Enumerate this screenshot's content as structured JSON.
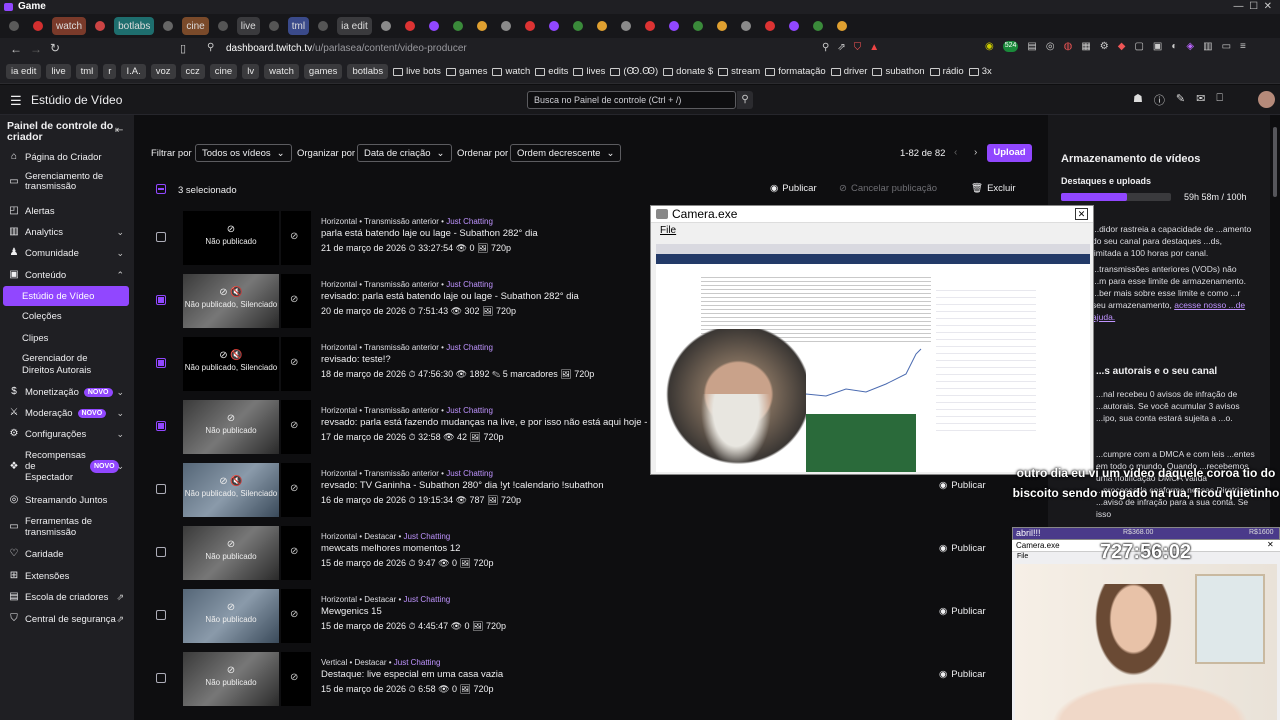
{
  "window": {
    "title": "Game"
  },
  "browser_tabs": [
    {
      "label": "",
      "color": "#5a5a5a"
    },
    {
      "label": "",
      "color": "#d32f2f"
    },
    {
      "label": "watch",
      "color": "#7a3a2a"
    },
    {
      "label": "",
      "color": "#c44"
    },
    {
      "label": "botlabs",
      "color": "#1e6e6e"
    },
    {
      "label": "",
      "color": "#666"
    },
    {
      "label": "cine",
      "color": "#7a4a2a"
    },
    {
      "label": "",
      "color": "#555"
    },
    {
      "label": "live",
      "color": "#3a3a3d"
    },
    {
      "label": "",
      "color": "#555"
    },
    {
      "label": "tml",
      "color": "#3a4a8a"
    },
    {
      "label": "",
      "color": "#555"
    },
    {
      "label": "ia edit",
      "color": "#3a3a3d"
    }
  ],
  "address": {
    "url_host": "dashboard.twitch.tv",
    "url_path": "/u/parlasea/content/video-producer"
  },
  "bookmarks": [
    {
      "label": "ia edit",
      "pill": true
    },
    {
      "label": "live",
      "pill": true
    },
    {
      "label": "tml",
      "pill": true
    },
    {
      "label": "r",
      "pill": true
    },
    {
      "label": "I.A.",
      "pill": true
    },
    {
      "label": "voz",
      "pill": true
    },
    {
      "label": "ccz",
      "pill": true
    },
    {
      "label": "cine",
      "pill": true
    },
    {
      "label": "lv",
      "pill": true
    },
    {
      "label": "watch",
      "pill": true
    },
    {
      "label": "games",
      "pill": true
    },
    {
      "label": "botlabs",
      "pill": true
    },
    {
      "label": "live bots",
      "pill": false
    },
    {
      "label": "games",
      "pill": false
    },
    {
      "label": "watch",
      "pill": false
    },
    {
      "label": "edits",
      "pill": false
    },
    {
      "label": "lives",
      "pill": false
    },
    {
      "label": "(Ꙭ.Ꙭ)",
      "pill": false
    },
    {
      "label": "donate $",
      "pill": false
    },
    {
      "label": "stream",
      "pill": false
    },
    {
      "label": "formatação",
      "pill": false
    },
    {
      "label": "driver",
      "pill": false
    },
    {
      "label": "subathon",
      "pill": false
    },
    {
      "label": "rádio",
      "pill": false
    },
    {
      "label": "3x",
      "pill": false
    }
  ],
  "header": {
    "title": "Estúdio de Vídeo",
    "search_placeholder": "Busca no Painel de controle (Ctrl + /)"
  },
  "sidebar": {
    "title": "Painel de controle do criador",
    "items": [
      {
        "label": "Página do Criador"
      },
      {
        "label": "Gerenciamento de transmissão"
      },
      {
        "label": "Alertas"
      },
      {
        "label": "Analytics"
      },
      {
        "label": "Comunidade"
      },
      {
        "label": "Conteúdo"
      },
      {
        "label": "Estúdio de Vídeo"
      },
      {
        "label": "Coleções"
      },
      {
        "label": "Clipes"
      },
      {
        "label": "Gerenciador de Direitos Autorais"
      },
      {
        "label": "Monetização",
        "badge": "NOVO"
      },
      {
        "label": "Moderação",
        "badge": "NOVO"
      },
      {
        "label": "Configurações"
      },
      {
        "label": "Recompensas de Espectador",
        "badge": "NOVO"
      },
      {
        "label": "Streamando Juntos"
      },
      {
        "label": "Ferramentas de transmissão"
      },
      {
        "label": "Caridade"
      },
      {
        "label": "Extensões"
      },
      {
        "label": "Escola de criadores"
      },
      {
        "label": "Central de segurança"
      }
    ]
  },
  "filters": {
    "filter_label": "Filtrar por",
    "filter_value": "Todos os vídeos",
    "organize_label": "Organizar por",
    "organize_value": "Data de criação",
    "order_label": "Ordenar por",
    "order_value": "Ordem decrescente",
    "pagination": "1-82 de 82",
    "upload": "Upload"
  },
  "bulk": {
    "selected": "3 selecionado",
    "publish": "Publicar",
    "cancel": "Cancelar publicação",
    "delete": "Excluir"
  },
  "videos": [
    {
      "meta": "Horizontal • Transmissão anterior • ",
      "category": "Just Chatting",
      "title": "parla está batendo laje ou lage - Subathon 282° dia",
      "stats": "21 de março de 2026  ⏱ 33:27:54  👁 0  🖼 720p",
      "thumb_label": "Não publicado",
      "checked": false,
      "publish": ""
    },
    {
      "meta": "Horizontal • Transmissão anterior • ",
      "category": "Just Chatting",
      "title": "revisado: parla está batendo laje ou lage - Subathon 282° dia",
      "stats": "20 de março de 2026  ⏱ 7:51:43  👁 302  🖼 720p",
      "thumb_label": "Não publicado, Silenciado",
      "checked": true,
      "publish": ""
    },
    {
      "meta": "Horizontal • Transmissão anterior • ",
      "category": "Just Chatting",
      "title": "revisado: teste!?",
      "stats": "18 de março de 2026  ⏱ 47:56:30  👁 1892  ✎ 5 marcadores  🖼 720p",
      "thumb_label": "Não publicado, Silenciado",
      "checked": true,
      "publish": ""
    },
    {
      "meta": "Horizontal • Transmissão anterior • ",
      "category": "Just Chatting",
      "title": "revsado: parla está fazendo mudanças na live, e por isso não está aqui hoje - Sub",
      "stats": "17 de março de 2026  ⏱ 32:58  👁 42  🖼 720p",
      "thumb_label": "Não publicado",
      "checked": true,
      "publish": ""
    },
    {
      "meta": "Horizontal • Transmissão anterior • ",
      "category": "Just Chatting",
      "title": "revsado: TV Ganinha - Subathon 280° dia !yt !calendario !subathon",
      "stats": "16 de março de 2026  ⏱ 19:15:34  👁 787  🖼 720p",
      "thumb_label": "Não publicado, Silenciado",
      "checked": false,
      "publish": "Publicar"
    },
    {
      "meta": "Horizontal • Destacar • ",
      "category": "Just Chatting",
      "title": "mewcats melhores momentos 12",
      "stats": "15 de março de 2026  ⏱ 9:47  👁 0  🖼 720p",
      "thumb_label": "Não publicado",
      "checked": false,
      "publish": "Publicar"
    },
    {
      "meta": "Horizontal • Destacar • ",
      "category": "Just Chatting",
      "title": "Mewgenics 15",
      "stats": "15 de março de 2026  ⏱ 4:45:47  👁 0  🖼 720p",
      "thumb_label": "Não publicado",
      "checked": false,
      "publish": "Publicar"
    },
    {
      "meta": "Vertical • Destacar • ",
      "category": "Just Chatting",
      "title": "Destaque: live especial em uma casa vazia",
      "stats": "15 de março de 2026  ⏱ 6:58  👁 0  🖼 720p",
      "thumb_label": "Não publicado",
      "checked": false,
      "publish": "Publicar"
    }
  ],
  "storage": {
    "title": "Armazenamento de vídeos",
    "subtitle": "Destaques e uploads",
    "usage": "59h 58m / 100h",
    "usage_fraction": 0.6,
    "p1": "...didor rastreia a capacidade de ...amento do seu canal para destaques ...ds, limitada a 100 horas por canal.",
    "p2": "...transmissões anteriores (VODs) não ...m para esse limite de armazenamento. ...ber mais sobre esse limite e como ...r seu armazenamento, ",
    "link": "acesse nosso ...de ajuda.",
    "h2": "...s autorais e o seu canal",
    "p3": "...nal recebeu 0 avisos de infração de ...autorais. Se você acumular 3 avisos ...ipo, sua conta estará sujeita a ...o.",
    "p4": "...cumpre com a DMCA e com leis ...entes em todo o mundo. Quando ...recebemos uma notificação DMCA válida ...processada conforme nossas Diretrizes ...aviso de infração para a sua conta. Se isso"
  },
  "overlay": {
    "cam1_title": "Camera.exe",
    "cam1_menu": "File",
    "caption": "outro dia eu vi um vídeo daquele coroa tio do biscoito sendo mogado na rua, ficou quietinho",
    "cam2_title": "Camera.exe",
    "cam2_menu": "File",
    "cam2_top": "abril!!!",
    "cam2_money_a": "R$368.00",
    "cam2_money_b": "R$1600",
    "cam2_timer": "727:56:02"
  }
}
